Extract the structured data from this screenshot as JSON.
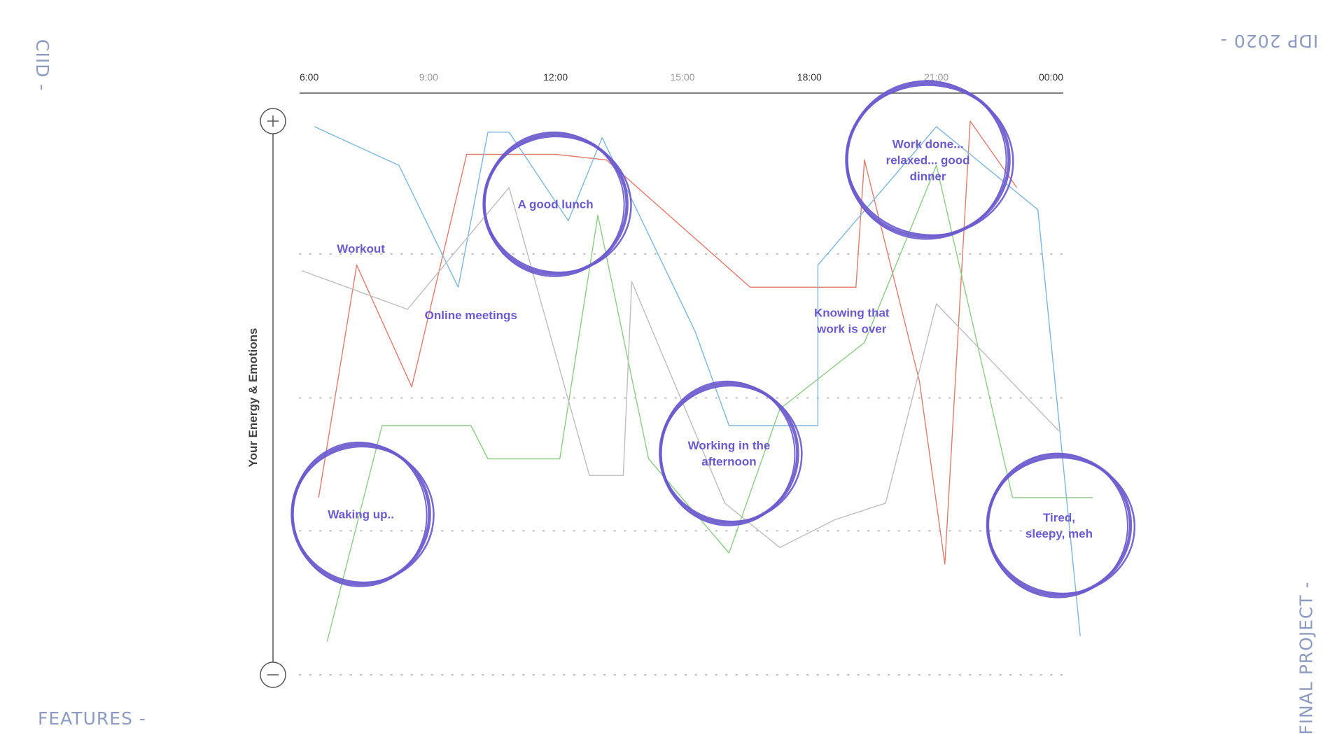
{
  "corners": {
    "top_left": "CIID -",
    "top_right": "IDP 2020 -",
    "bottom_left": "FEATURES -",
    "bottom_right": "FINAL PROJECT -"
  },
  "colors": {
    "accent": "#6a5acd",
    "corner_text": "#8e9bc0",
    "axis": "#555555",
    "grid": "#bbbbbb"
  },
  "chart_data": {
    "type": "line",
    "title": "",
    "xlabel": "",
    "ylabel": "Your Energy & Emotions",
    "xlim": [
      6,
      24
    ],
    "ylim": [
      0,
      100
    ],
    "x_ticks": [
      {
        "value": 6,
        "label": "6:00",
        "emphasis": true
      },
      {
        "value": 9,
        "label": "9:00",
        "emphasis": false
      },
      {
        "value": 12,
        "label": "12:00",
        "emphasis": true
      },
      {
        "value": 15,
        "label": "15:00",
        "emphasis": false
      },
      {
        "value": 18,
        "label": "18:00",
        "emphasis": true
      },
      {
        "value": 21,
        "label": "21:00",
        "emphasis": false
      },
      {
        "value": 24,
        "label": "00:00",
        "emphasis": true
      }
    ],
    "grid_levels": [
      76,
      50,
      26,
      0
    ],
    "grid": "dotted horizontal",
    "legend": "none",
    "y_axis_icons": {
      "top": "plus-icon",
      "bottom": "minus-icon"
    },
    "series": [
      {
        "color": "#e07b6e",
        "points": [
          [
            6.4,
            32
          ],
          [
            7.3,
            74
          ],
          [
            8.6,
            52
          ],
          [
            9.9,
            94
          ],
          [
            12,
            94
          ],
          [
            13.2,
            93
          ],
          [
            16.6,
            70
          ],
          [
            19.1,
            70
          ],
          [
            19.3,
            93
          ],
          [
            20.6,
            53
          ],
          [
            21.2,
            20
          ],
          [
            21.8,
            100
          ],
          [
            22.9,
            88
          ]
        ]
      },
      {
        "color": "#7eb6dc",
        "points": [
          [
            6.3,
            99
          ],
          [
            8.3,
            92
          ],
          [
            9.7,
            70
          ],
          [
            10.4,
            98
          ],
          [
            10.9,
            98
          ],
          [
            12.3,
            82
          ],
          [
            13.1,
            97
          ],
          [
            15.3,
            62
          ],
          [
            16.1,
            45
          ],
          [
            18.2,
            45
          ],
          [
            18.2,
            74
          ],
          [
            21.0,
            99
          ],
          [
            23.4,
            84
          ],
          [
            24.4,
            7
          ]
        ]
      },
      {
        "color": "#8ccc84",
        "points": [
          [
            6.6,
            6
          ],
          [
            7.9,
            45
          ],
          [
            10,
            45
          ],
          [
            10.4,
            39
          ],
          [
            12.1,
            39
          ],
          [
            13,
            83
          ],
          [
            14.2,
            39
          ],
          [
            16.1,
            22
          ],
          [
            17.3,
            48
          ],
          [
            19.3,
            60
          ],
          [
            21.0,
            92
          ],
          [
            22.8,
            32
          ],
          [
            24.7,
            32
          ]
        ]
      },
      {
        "color": "#bdbdbd",
        "points": [
          [
            6,
            73
          ],
          [
            8.5,
            66
          ],
          [
            10.9,
            88
          ],
          [
            12.8,
            36
          ],
          [
            13.6,
            36
          ],
          [
            13.8,
            71
          ],
          [
            16,
            31
          ],
          [
            17.3,
            23
          ],
          [
            18.6,
            28
          ],
          [
            19.8,
            31
          ],
          [
            21.0,
            67
          ],
          [
            23.9,
            44
          ]
        ]
      }
    ],
    "annotations": [
      {
        "label_lines": [
          "Waking up.."
        ],
        "circled": true,
        "data_x": 7.4,
        "data_y": 29
      },
      {
        "label_lines": [
          "Workout"
        ],
        "circled": false,
        "data_x": 7.4,
        "data_y": 77
      },
      {
        "label_lines": [
          "Online meetings"
        ],
        "circled": false,
        "data_x": 10.0,
        "data_y": 65
      },
      {
        "label_lines": [
          "A good lunch"
        ],
        "circled": true,
        "data_x": 12.0,
        "data_y": 85
      },
      {
        "label_lines": [
          "Working in the",
          "afternoon"
        ],
        "circled": true,
        "data_x": 16.1,
        "data_y": 40
      },
      {
        "label_lines": [
          "Knowing that",
          "work is over"
        ],
        "circled": false,
        "data_x": 19.0,
        "data_y": 64
      },
      {
        "label_lines": [
          "Work done...",
          "relaxed... good",
          "dinner"
        ],
        "circled": true,
        "data_x": 20.8,
        "data_y": 93
      },
      {
        "label_lines": [
          "Tired,",
          "sleepy, meh"
        ],
        "circled": true,
        "data_x": 23.9,
        "data_y": 27
      }
    ]
  }
}
